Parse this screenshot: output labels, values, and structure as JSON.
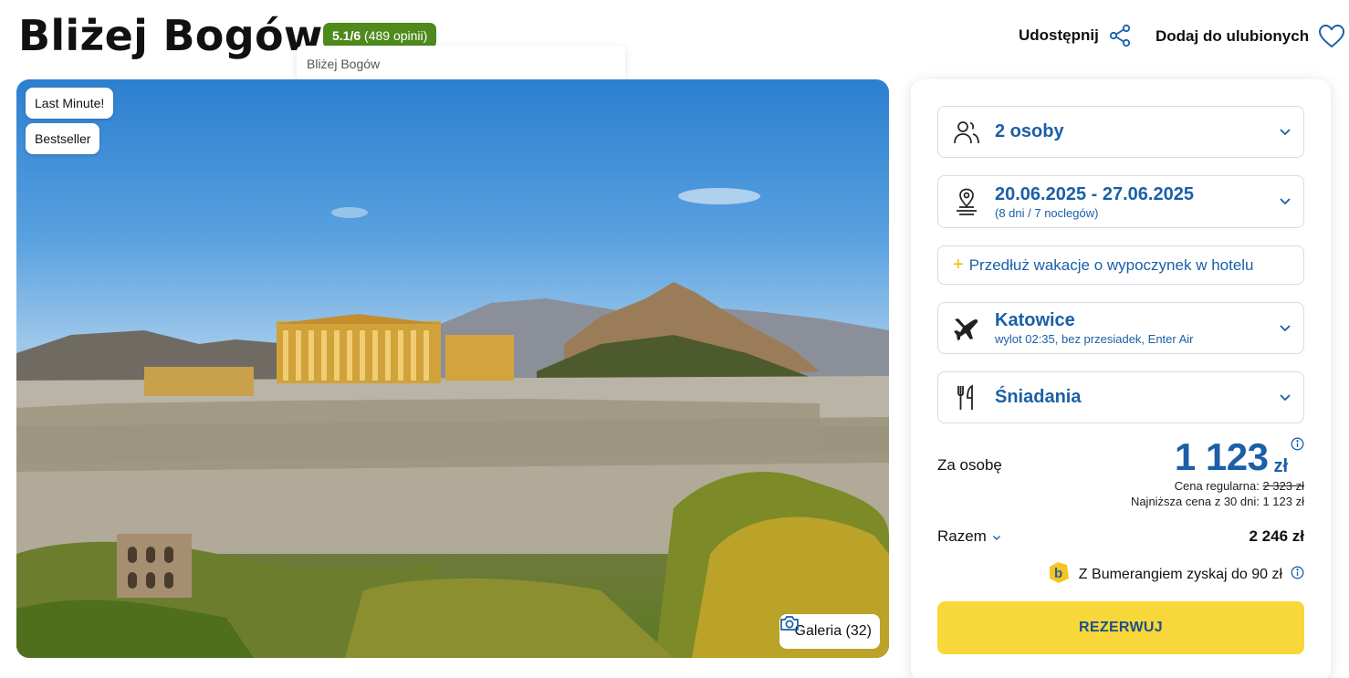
{
  "hotel": {
    "name": "Bliżej Bogów",
    "rating_score": "5.1/6",
    "rating_count": "(489 opinii)",
    "tooltip": "Bliżej Bogów"
  },
  "header": {
    "share_label": "Udostępnij",
    "favorite_label": "Dodaj do ulubionych"
  },
  "hero": {
    "tags": [
      "Last Minute!",
      "Bestseller"
    ],
    "gallery_label": "Galeria (32)"
  },
  "booking": {
    "persons": "2 osoby",
    "dates": "20.06.2025 - 27.06.2025",
    "duration": "(8 dni / 7 noclegów)",
    "extend": "Przedłuż wakacje o wypoczynek w hotelu",
    "departure_city": "Katowice",
    "flight_info": "wylot 02:35, bez przesiadek, Enter Air",
    "board": "Śniadania",
    "per_person_label": "Za osobę",
    "price_amount": "1 123",
    "price_currency": "zł",
    "regular_label": "Cena regularna:",
    "regular_price": "2 323 zł",
    "lowest_30": "Najniższa cena z 30 dni: 1 123 zł",
    "total_label": "Razem",
    "total_value": "2 246 zł",
    "bumerang_text": "Z Bumerangiem zyskaj do 90 zł",
    "reserve_label": "REZERWUJ"
  },
  "colors": {
    "accent_blue": "#1a5fa8",
    "rating_green": "#4e8a1c",
    "reserve_yellow": "#f8d73a",
    "plus_yellow": "#f0b800"
  },
  "icons": {
    "share": "share-icon",
    "favorite": "heart-icon",
    "persons": "users-icon",
    "dates": "location-pin-icon",
    "departure": "plane-icon",
    "board": "cutlery-icon",
    "gallery": "camera-icon",
    "bumerang": "bumerang-logo-icon",
    "info": "info-icon"
  }
}
